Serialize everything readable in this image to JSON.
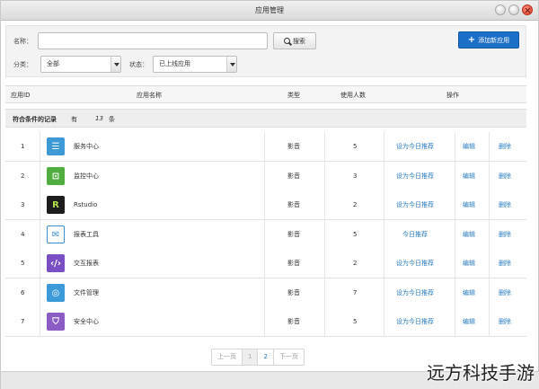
{
  "window": {
    "title": "应用管理"
  },
  "filter": {
    "name_label": "名称：",
    "name_value": "",
    "search_label": "搜索",
    "category_label": "分类：",
    "category_value": "全部",
    "status_label": "状态：",
    "status_value": "已上线应用",
    "add_label": "添加新应用"
  },
  "table": {
    "headers": {
      "id": "应用ID",
      "name": "应用名称",
      "type": "类型",
      "users": "使用人数",
      "actions": "操作"
    },
    "summary": {
      "prefix": "符合条件的记录",
      "has": "有",
      "count": "13",
      "unit": "条"
    },
    "rows": [
      {
        "id": "1",
        "icon": "server-icon",
        "color": "#3d9ad6",
        "name": "服务中心",
        "type": "影音",
        "users": "5",
        "action1": "设为今日推荐",
        "edit": "编辑",
        "delete": "删除"
      },
      {
        "id": "2",
        "icon": "monitor-icon",
        "color": "#4fae3f",
        "name": "监控中心",
        "type": "影音",
        "users": "3",
        "action1": "设为今日推荐",
        "edit": "编辑",
        "delete": "删除"
      },
      {
        "id": "3",
        "icon": "rstudio-icon",
        "color": "#1d1d1d",
        "name": "Rstudio",
        "type": "影音",
        "users": "2",
        "action1": "设为今日推荐",
        "edit": "编辑",
        "delete": "删除"
      },
      {
        "id": "4",
        "icon": "mail-icon",
        "color": "#3d8fd2",
        "name": "报表工具",
        "type": "影音",
        "users": "5",
        "action1": "今日推荐",
        "edit": "编辑",
        "delete": "删除"
      },
      {
        "id": "5",
        "icon": "code-icon",
        "color": "#7a4fc4",
        "name": "交互报表",
        "type": "影音",
        "users": "2",
        "action1": "设为今日推荐",
        "edit": "编辑",
        "delete": "删除"
      },
      {
        "id": "6",
        "icon": "chrome-icon",
        "color": "#3c9ad8",
        "name": "文件管理",
        "type": "影音",
        "users": "7",
        "action1": "设为今日推荐",
        "edit": "编辑",
        "delete": "删除"
      },
      {
        "id": "7",
        "icon": "shield-icon",
        "color": "#8a5cc4",
        "name": "安全中心",
        "type": "影音",
        "users": "5",
        "action1": "设为今日推荐",
        "edit": "编辑",
        "delete": "删除"
      }
    ]
  },
  "pager": {
    "prev": "上一页",
    "page1": "1",
    "page2": "2",
    "next": "下一页"
  },
  "watermark": "远方科技手游"
}
